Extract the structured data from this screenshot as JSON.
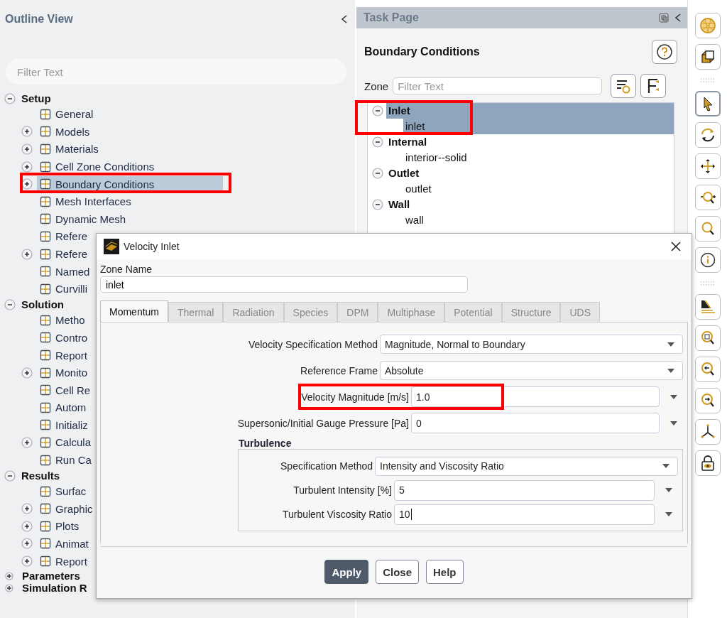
{
  "outline": {
    "title": "Outline View",
    "filter": {
      "placeholder": "Filter Text"
    },
    "tree": [
      {
        "label": "Setup",
        "expanded": true,
        "children": [
          {
            "label": "General",
            "selected": false
          },
          {
            "label": "Models",
            "expanded": false,
            "selected": false
          },
          {
            "label": "Materials",
            "expanded": false,
            "selected": false
          },
          {
            "label": "Cell Zone Conditions",
            "expanded": false,
            "selected": false
          },
          {
            "label": "Boundary Conditions",
            "expanded": false,
            "selected": true,
            "highlighted": true
          },
          {
            "label": "Mesh Interfaces",
            "selected": false
          },
          {
            "label": "Dynamic Mesh",
            "selected": false
          },
          {
            "label": "Refere",
            "selected": false
          },
          {
            "label": "Refere",
            "expanded": false,
            "selected": false
          },
          {
            "label": "Named",
            "selected": false
          },
          {
            "label": "Curvilli",
            "selected": false
          }
        ]
      },
      {
        "label": "Solution",
        "expanded": true,
        "children": [
          {
            "label": "Metho",
            "selected": false
          },
          {
            "label": "Contro",
            "selected": false
          },
          {
            "label": "Report",
            "selected": false
          },
          {
            "label": "Monito",
            "expanded": false,
            "selected": false
          },
          {
            "label": "Cell Re",
            "selected": false
          },
          {
            "label": "Autom",
            "selected": false
          },
          {
            "label": "Initializ",
            "selected": false
          },
          {
            "label": "Calcula",
            "expanded": false,
            "selected": false
          },
          {
            "label": "Run Ca",
            "selected": false
          }
        ]
      },
      {
        "label": "Results",
        "expanded": true,
        "children": [
          {
            "label": "Surfac",
            "selected": false
          },
          {
            "label": "Graphic",
            "expanded": false,
            "selected": false
          },
          {
            "label": "Plots",
            "expanded": false,
            "selected": false
          },
          {
            "label": "Animat",
            "expanded": false,
            "selected": false
          },
          {
            "label": "Report",
            "expanded": false,
            "selected": false
          }
        ]
      },
      {
        "label": "Parameters",
        "expanded": false
      },
      {
        "label": "Simulation R",
        "expanded": false
      }
    ]
  },
  "task_page": {
    "title": "Task Page",
    "heading": "Boundary Conditions",
    "zone_label": "Zone",
    "zone_filter": {
      "placeholder": "Filter Text"
    },
    "zones": [
      {
        "label": "Inlet",
        "expanded": true,
        "selected": true,
        "highlighted": true,
        "children": [
          {
            "label": "inlet",
            "selected": true
          }
        ]
      },
      {
        "label": "Internal",
        "expanded": true,
        "selected": false,
        "children": [
          {
            "label": "interior--solid",
            "selected": false
          }
        ]
      },
      {
        "label": "Outlet",
        "expanded": true,
        "selected": false,
        "children": [
          {
            "label": "outlet",
            "selected": false
          }
        ]
      },
      {
        "label": "Wall",
        "expanded": true,
        "selected": false,
        "children": [
          {
            "label": "wall",
            "selected": false
          }
        ]
      }
    ]
  },
  "toolbar": [
    {
      "kind": "sphere",
      "selected": false
    },
    {
      "kind": "cube",
      "selected": false
    },
    {
      "kind": "grip"
    },
    {
      "kind": "pointer",
      "selected": true
    },
    {
      "kind": "rotate",
      "selected": false
    },
    {
      "kind": "move",
      "selected": false
    },
    {
      "kind": "zoom-plus",
      "selected": false
    },
    {
      "kind": "zoom",
      "selected": false
    },
    {
      "kind": "info",
      "selected": false
    },
    {
      "kind": "grip"
    },
    {
      "kind": "ruler",
      "selected": false
    },
    {
      "kind": "zoom-box",
      "selected": false
    },
    {
      "kind": "zoom-left",
      "selected": false
    },
    {
      "kind": "zoom-right",
      "selected": false
    },
    {
      "kind": "axes",
      "selected": false
    },
    {
      "kind": "lock",
      "selected": false
    }
  ],
  "dialog": {
    "title": "Velocity Inlet",
    "zone_name_label": "Zone Name",
    "zone_name": "inlet",
    "tabs": [
      {
        "label": "Momentum",
        "selected": true
      },
      {
        "label": "Thermal",
        "selected": false
      },
      {
        "label": "Radiation",
        "selected": false
      },
      {
        "label": "Species",
        "selected": false
      },
      {
        "label": "DPM",
        "selected": false
      },
      {
        "label": "Multiphase",
        "selected": false
      },
      {
        "label": "Potential",
        "selected": false
      },
      {
        "label": "Structure",
        "selected": false
      },
      {
        "label": "UDS",
        "selected": false
      }
    ],
    "fields": [
      {
        "kind": "dropdown",
        "label": "Velocity Specification Method",
        "value": "Magnitude, Normal to Boundary"
      },
      {
        "kind": "dropdown",
        "label": "Reference Frame",
        "value": "Absolute"
      },
      {
        "kind": "number",
        "label": "Velocity Magnitude [m/s]",
        "value": "1.0",
        "highlighted": true
      },
      {
        "kind": "number",
        "label": "Supersonic/Initial Gauge Pressure [Pa]",
        "value": "0"
      }
    ],
    "group": {
      "title": "Turbulence",
      "fields": [
        {
          "kind": "dropdown",
          "label": "Specification Method",
          "value": "Intensity and Viscosity Ratio"
        },
        {
          "kind": "number",
          "label": "Turbulent Intensity [%]",
          "value": "5"
        },
        {
          "kind": "number",
          "label": "Turbulent Viscosity Ratio",
          "value": "10",
          "focused": true
        }
      ]
    },
    "buttons": [
      {
        "label": "Apply",
        "kind": "primary"
      },
      {
        "label": "Close",
        "kind": "default"
      },
      {
        "label": "Help",
        "kind": "default"
      }
    ]
  }
}
